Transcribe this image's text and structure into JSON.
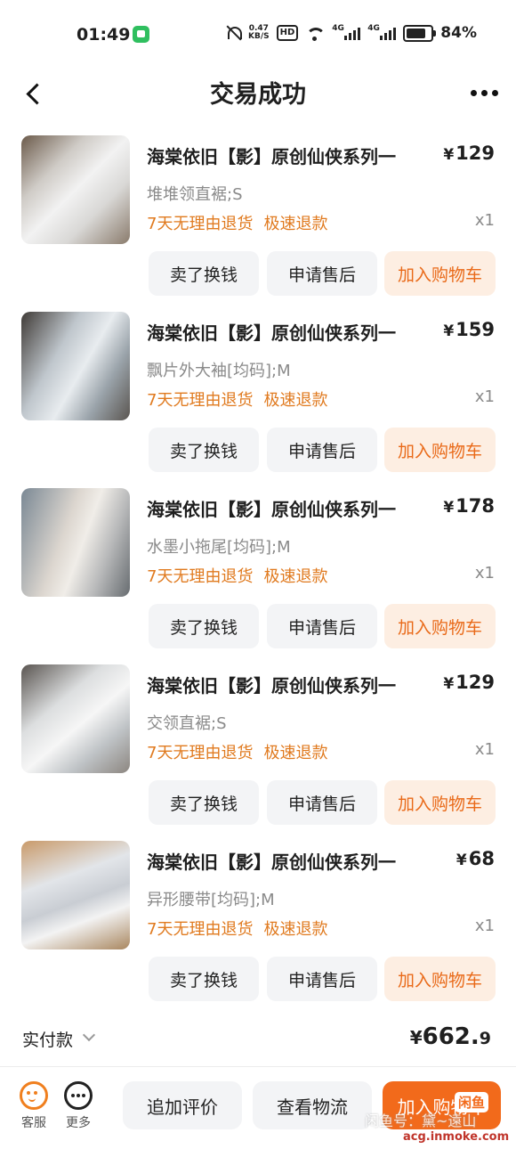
{
  "status_bar": {
    "time": "01:49",
    "net_speed_value": "0.47",
    "net_speed_unit": "KB/S",
    "hd_label": "HD",
    "sim1": "4G",
    "sim2": "4G",
    "battery": "84%"
  },
  "header": {
    "title": "交易成功"
  },
  "orders": [
    {
      "name": "海棠依旧【影】原创仙侠系列一",
      "price_symbol": "¥",
      "price": "129",
      "spec": "堆堆领直裾;S",
      "tag1": "7天无理由退货",
      "tag2": "极速退款",
      "qty": "x1",
      "btn_sell": "卖了换钱",
      "btn_service": "申请售后",
      "btn_cart": "加入购物车"
    },
    {
      "name": "海棠依旧【影】原创仙侠系列一",
      "price_symbol": "¥",
      "price": "159",
      "spec": "飘片外大袖[均码];M",
      "tag1": "7天无理由退货",
      "tag2": "极速退款",
      "qty": "x1",
      "btn_sell": "卖了换钱",
      "btn_service": "申请售后",
      "btn_cart": "加入购物车"
    },
    {
      "name": "海棠依旧【影】原创仙侠系列一",
      "price_symbol": "¥",
      "price": "178",
      "spec": "水墨小拖尾[均码];M",
      "tag1": "7天无理由退货",
      "tag2": "极速退款",
      "qty": "x1",
      "btn_sell": "卖了换钱",
      "btn_service": "申请售后",
      "btn_cart": "加入购物车"
    },
    {
      "name": "海棠依旧【影】原创仙侠系列一",
      "price_symbol": "¥",
      "price": "129",
      "spec": "交领直裾;S",
      "tag1": "7天无理由退货",
      "tag2": "极速退款",
      "qty": "x1",
      "btn_sell": "卖了换钱",
      "btn_service": "申请售后",
      "btn_cart": "加入购物车"
    },
    {
      "name": "海棠依旧【影】原创仙侠系列一",
      "price_symbol": "¥",
      "price": "68",
      "spec": "异形腰带[均码];M",
      "tag1": "7天无理由退货",
      "tag2": "极速退款",
      "qty": "x1",
      "btn_sell": "卖了换钱",
      "btn_service": "申请售后",
      "btn_cart": "加入购物车"
    }
  ],
  "summary": {
    "label": "实付款",
    "symbol": "¥",
    "amount_int": "662.",
    "amount_dec": "9"
  },
  "bottom_bar": {
    "service_label": "客服",
    "more_label": "更多",
    "review_button": "追加评价",
    "logistics_button": "查看物流",
    "cart_button": "加入购物车"
  },
  "watermarks": {
    "app_logo": "闲鱼",
    "seller": "闲鱼号：黛~遠山",
    "site": "acg.inmoke.com"
  },
  "colors": {
    "accent": "#f26a1b",
    "tag_text": "#e07a1f",
    "muted_text": "#8a8a8a"
  }
}
